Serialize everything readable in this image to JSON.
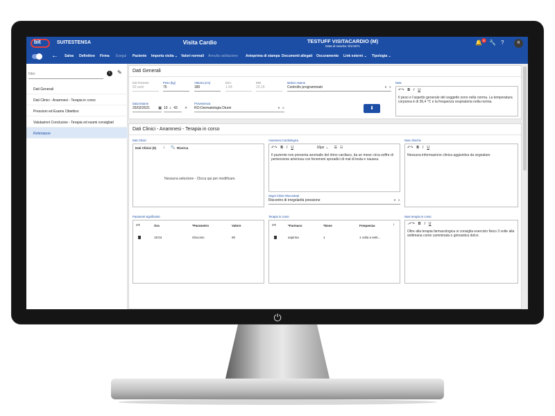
{
  "header": {
    "app_name": "SUITESTENSA",
    "logo_text": "bit",
    "window_title": "Visita Cardio",
    "patient_name": "TESTUFF VISITACARDIO (M)",
    "patient_birth": "Data di nascita: 8/1/1971",
    "notification_count": "6",
    "avatar_initial": "R"
  },
  "toolbar": {
    "items": [
      "Salva",
      "Definitivo",
      "Firma",
      "Esegui",
      "Paziente",
      "Importa visita ⌄",
      "Valori normali",
      "Annulla validazione",
      "Anteprima di stampa",
      "Documenti allegati",
      "Oscuramento",
      "Link esterni ⌄",
      "Tipologia ⌄"
    ]
  },
  "sidebar": {
    "filter_placeholder": "Filtri",
    "items": [
      "Dati Generali",
      "Dati Clinici - Anamnesi - Terapia in corso",
      "Pressioni ed Esame Obiettivo",
      "Valutazioni Conclusive - Terapia ed esami consigliati",
      "Refertatore"
    ]
  },
  "dati_generali": {
    "title": "Dati Generali",
    "eta_label": "Età Paziente",
    "eta_value": "50 anni",
    "peso_label": "Peso (kg)",
    "peso_value": "75",
    "altezza_label": "Altezza (cm)",
    "altezza_value": "180",
    "bsa_label": "BSA",
    "bsa_value": "1.94",
    "bmi_label": "BMI",
    "bmi_value": "23.15",
    "motivo_label": "Motivo esame",
    "motivo_value": "Controllo programmato",
    "note_label": "Note",
    "note_text": "Il peso e l'aspetto generale del soggetto sono nella norma. La temperatura corporea è di 36,4 °C e la frequenza respiratoria nella norma.",
    "data_label": "Data Esame",
    "data_value": "25/02/2021",
    "ora_value": "10",
    "min_value": "43",
    "provenienza_label": "Provenienza",
    "provenienza_value": "RO-Dermatologia Diurni"
  },
  "dati_clinici": {
    "title": "Dati Clinici - Anamnesi - Terapia in corso",
    "dc_label": "Dati Clinici",
    "dc_header": "Dati Clinici (0)",
    "dc_search": "Ricerca",
    "dc_empty": "Nessuna selezione - Clicca qui per modificare.",
    "anamnesi_label": "Anamnesi Cardiologica",
    "anamnesi_text": "Il paziente non presenta anomalie del ritmo cardiaco, da un mese circa soffre di pertensione arteriosa con fenomeni sporadici di mal di testa e nausea.",
    "font_size": "16px",
    "segni_label": "Segni Clinici Riscontrati",
    "segni_value": "Riscontro di irregolarità pressione",
    "note_cliniche_label": "Note cliniche",
    "note_cliniche_text": "Nessuna informazione clinica aggiuntiva da segnalare",
    "parametri_label": "Parametri significativi",
    "parametri_headers": [
      "Ora",
      "*Parametro",
      "Valore"
    ],
    "parametri_row": [
      "18:04",
      "Glucosio",
      "90"
    ],
    "terapia_label": "Terapia in corso",
    "terapia_headers": [
      "*Farmaco",
      "*Dose",
      "Frequenza"
    ],
    "terapia_row": [
      "aspirina",
      "1",
      "1 volta a setti..."
    ],
    "note_terapia_label": "Note terapia in corso",
    "note_terapia_text": "Oltre alla terapia farmacologica si consiglia esercizio fisico 3 volte alla settimana come camminata o ginnastica dolce."
  },
  "icons": [
    "power-icon",
    "bell-icon",
    "wrench-icon",
    "help-icon",
    "back-arrow-icon",
    "info-icon",
    "pencil-icon",
    "calendar-icon",
    "download-icon",
    "search-icon",
    "undo-icon",
    "redo-icon",
    "trash-icon"
  ]
}
